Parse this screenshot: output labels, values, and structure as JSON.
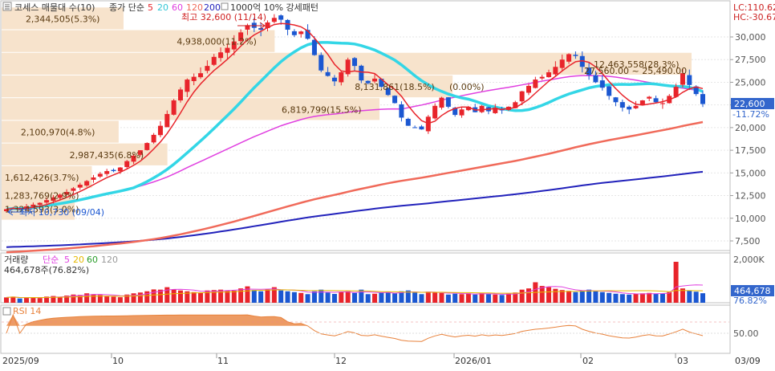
{
  "colors": {
    "up": "#e8242b",
    "down": "#1b57d1",
    "ma5": "#e8242b",
    "ma20": "#33d6e6",
    "ma60": "#e040e0",
    "ma120": "#f06a5a",
    "ma200": "#2222bb",
    "volume_profile": "#f7e3cc",
    "rsi": "#e8823c",
    "lc_hc": "#cc2222",
    "price_box": "#3366cc"
  },
  "header": {
    "menu_icon": "menu-icon",
    "title": "코세스 매물대 수(10)",
    "ma_label": "종가 단순",
    "ma5": "5",
    "ma20": "20",
    "ma60": "60",
    "ma120": "120",
    "ma200": "200",
    "extra": "1000억 10% 강세패턴",
    "lc": "LC:110.62",
    "hc": "HC:-30.67"
  },
  "price_panel": {
    "y_ticks": [
      "30,000",
      "27,500",
      "25,000",
      "22,500",
      "20,000",
      "17,500",
      "15,000",
      "12,500",
      "10,000",
      "7,500"
    ],
    "current_price": "22,600",
    "current_change": "-11.72%",
    "high_annotation": "최고 32,600 (11/14)",
    "low_annotation": "최저 10,730 (09/04)",
    "profile_labels": [
      "2,344,505(5.3%)",
      "4,938,000(11.2%)",
      "12,463,558(28.3%)",
      "8,131,861(18.5%)",
      "6,819,799(15.5%)",
      "2,100,970(4.8%)",
      "2,987,435(6.8%)",
      "1,612,426(3.7%)",
      "1,283,769(2.9%)",
      "1,324,593(3.0%)"
    ],
    "range_label": "27,560.00 ~ 25,490.00",
    "pct_label": "(0.00%)"
  },
  "volume_panel": {
    "legend_title": "거래량",
    "legend_ma": "단순",
    "ma5": "5",
    "ma20": "20",
    "ma60": "60",
    "ma120": "120",
    "value": "464,678주(76.82%)",
    "y_tick": "2,000K",
    "current_value": "464,678",
    "current_pct": "76.82%"
  },
  "rsi_panel": {
    "title": "RSI 14",
    "y_tick": "50.00"
  },
  "x_axis": {
    "labels": [
      "2025/09",
      "10",
      "11",
      "12",
      "2026/01",
      "02",
      "03",
      "03/09"
    ]
  },
  "chart_data": {
    "type": "candlestick",
    "title": "코세스",
    "x_labels": [
      "2025/09",
      "10",
      "11",
      "12",
      "2026/01",
      "02",
      "03",
      "03/09"
    ],
    "y_axis": {
      "min": 7500,
      "max": 30000,
      "step": 2500
    },
    "last_close": 22600,
    "last_change_pct": -11.72,
    "high": {
      "value": 32600,
      "date": "11/14"
    },
    "low": {
      "value": 10730,
      "date": "09/04"
    },
    "volume_profile": [
      {
        "label": "2,344,505(5.3%)",
        "value": 2344505,
        "pct": 5.3
      },
      {
        "label": "4,938,000(11.2%)",
        "value": 4938000,
        "pct": 11.2
      },
      {
        "label": "12,463,558(28.3%)",
        "value": 12463558,
        "pct": 28.3
      },
      {
        "label": "8,131,861(18.5%)",
        "value": 8131861,
        "pct": 18.5
      },
      {
        "label": "6,819,799(15.5%)",
        "value": 6819799,
        "pct": 15.5
      },
      {
        "label": "2,100,970(4.8%)",
        "value": 2100970,
        "pct": 4.8
      },
      {
        "label": "2,987,435(6.8%)",
        "value": 2987435,
        "pct": 6.8
      },
      {
        "label": "1,612,426(3.7%)",
        "value": 1612426,
        "pct": 3.7
      },
      {
        "label": "1,283,769(2.9%)",
        "value": 1283769,
        "pct": 2.9
      },
      {
        "label": "1,324,593(3.0%)",
        "value": 1324593,
        "pct": 3.0
      }
    ],
    "closes": [
      11000,
      11150,
      11000,
      11300,
      11500,
      11700,
      12000,
      12300,
      12600,
      12900,
      13300,
      13700,
      14100,
      14500,
      14900,
      15200,
      15200,
      15600,
      16300,
      16900,
      17500,
      18300,
      19200,
      20200,
      21500,
      23000,
      24200,
      25300,
      25600,
      26000,
      26800,
      27800,
      28300,
      28800,
      29500,
      30500,
      31300,
      31000,
      30800,
      31600,
      32100,
      31900,
      30800,
      30200,
      30600,
      29800,
      28000,
      26300,
      25700,
      25100,
      26100,
      27500,
      26800,
      25200,
      24900,
      25400,
      24500,
      23600,
      22700,
      21100,
      20200,
      20000,
      19800,
      21200,
      22400,
      23300,
      22300,
      21400,
      22000,
      22300,
      21700,
      22400,
      21800,
      22200,
      21900,
      22300,
      22800,
      24000,
      24600,
      25300,
      25600,
      26100,
      26700,
      27500,
      28100,
      27900,
      26700,
      25800,
      25000,
      24400,
      23500,
      22800,
      22200,
      22000,
      22400,
      23000,
      23400,
      22800,
      22700,
      23500,
      24500,
      26000,
      24700,
      23700,
      22600
    ],
    "volume": [
      260000,
      300000,
      210000,
      240000,
      270000,
      230000,
      300000,
      330000,
      280000,
      350000,
      400000,
      380000,
      460000,
      420000,
      380000,
      330000,
      300000,
      270000,
      400000,
      460000,
      500000,
      560000,
      650000,
      640000,
      760000,
      650000,
      600000,
      560000,
      520000,
      500000,
      600000,
      620000,
      640000,
      600000,
      590000,
      700000,
      800000,
      620000,
      560000,
      650000,
      760000,
      600000,
      560000,
      520000,
      480000,
      420000,
      560000,
      640000,
      500000,
      430000,
      520000,
      560000,
      480000,
      640000,
      420000,
      440000,
      500000,
      520000,
      460000,
      560000,
      600000,
      500000,
      420000,
      540000,
      520000,
      480000,
      400000,
      440000,
      420000,
      460000,
      400000,
      480000,
      420000,
      400000,
      380000,
      440000,
      500000,
      640000,
      700000,
      1000000,
      820000,
      760000,
      680000,
      620000,
      580000,
      520000,
      600000,
      640000,
      560000,
      520000,
      480000,
      440000,
      420000,
      400000,
      430000,
      460000,
      480000,
      440000,
      440000,
      520000,
      2000000,
      700000,
      600000,
      540000,
      464678
    ]
  }
}
